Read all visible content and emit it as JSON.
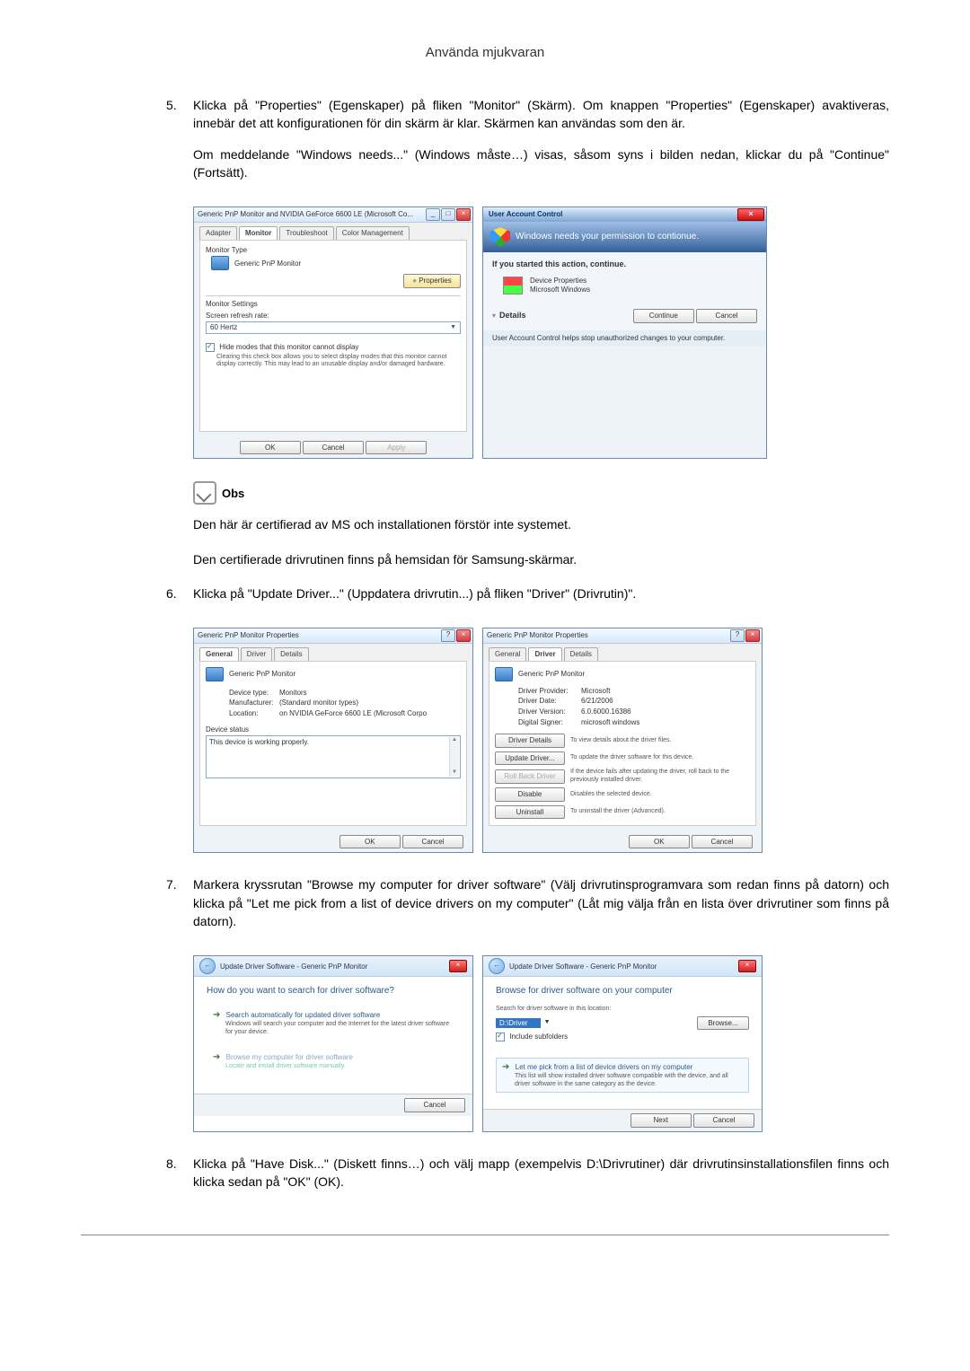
{
  "page_header": "Använda mjukvaran",
  "step5": {
    "num": "5.",
    "p1": "Klicka på \"Properties\" (Egenskaper) på fliken \"Monitor\" (Skärm). Om knappen \"Properties\" (Egenskaper) avaktiveras, innebär det att konfigurationen för din skärm är klar. Skärmen kan användas som den är.",
    "p2": "Om meddelande \"Windows needs...\" (Windows måste…) visas, såsom syns i bilden nedan, klickar du på \"Continue\" (Fortsätt)."
  },
  "dlg_monitor": {
    "title": "Generic PnP Monitor and NVIDIA GeForce 6600 LE (Microsoft Co...",
    "tabs": [
      "Adapter",
      "Monitor",
      "Troubleshoot",
      "Color Management"
    ],
    "monitor_type_label": "Monitor Type",
    "monitor_name": "Generic PnP Monitor",
    "properties_btn": "Properties",
    "monitor_settings_label": "Monitor Settings",
    "refresh_label": "Screen refresh rate:",
    "refresh_value": "60 Hertz",
    "hide_modes": "Hide modes that this monitor cannot display",
    "hide_modes_help": "Clearing this check box allows you to select display modes that this monitor cannot display correctly. This may lead to an unusable display and/or damaged hardware.",
    "ok": "OK",
    "cancel": "Cancel",
    "apply": "Apply"
  },
  "dlg_uac": {
    "title": "User Account Control",
    "headline": "Windows needs your permission to contionue.",
    "subline": "If you started this action, continue.",
    "prog_name": "Device Properties",
    "prog_pub": "Microsoft Windows",
    "details": "Details",
    "continue": "Continue",
    "cancel": "Cancel",
    "footer": "User Account Control helps stop unauthorized changes to your computer."
  },
  "note": {
    "label": "Obs",
    "line1": "Den här är certifierad av MS och installationen förstör inte systemet.",
    "line2": "Den certifierade drivrutinen finns på hemsidan för Samsung-skärmar."
  },
  "step6": {
    "num": "6.",
    "p1": "Klicka på \"Update Driver...\" (Uppdatera drivrutin...) på fliken \"Driver\" (Drivrutin)\"."
  },
  "dlg_prop_general": {
    "title": "Generic PnP Monitor Properties",
    "tabs": [
      "General",
      "Driver",
      "Details"
    ],
    "name": "Generic PnP Monitor",
    "device_type_l": "Device type:",
    "device_type_v": "Monitors",
    "manufacturer_l": "Manufacturer:",
    "manufacturer_v": "(Standard monitor types)",
    "location_l": "Location:",
    "location_v": "on NVIDIA GeForce 6600 LE (Microsoft Corpo",
    "status_l": "Device status",
    "status_v": "This device is working properly.",
    "ok": "OK",
    "cancel": "Cancel"
  },
  "dlg_prop_driver": {
    "title": "Generic PnP Monitor Properties",
    "tabs": [
      "General",
      "Driver",
      "Details"
    ],
    "name": "Generic PnP Monitor",
    "provider_l": "Driver Provider:",
    "provider_v": "Microsoft",
    "date_l": "Driver Date:",
    "date_v": "6/21/2006",
    "version_l": "Driver Version:",
    "version_v": "6.0.6000.16386",
    "signer_l": "Digital Signer:",
    "signer_v": "microsoft windows",
    "b1": "Driver Details",
    "b1d": "To view details about the driver files.",
    "b2": "Update Driver...",
    "b2d": "To update the driver software for this device.",
    "b3": "Roll Back Driver",
    "b3d": "If the device fails after updating the driver, roll back to the previously installed driver.",
    "b4": "Disable",
    "b4d": "Disables the selected device.",
    "b5": "Uninstall",
    "b5d": "To uninstall the driver (Advanced).",
    "ok": "OK",
    "cancel": "Cancel"
  },
  "step7": {
    "num": "7.",
    "p1": "Markera kryssrutan \"Browse my computer for driver software\" (Välj drivrutinsprogramvara som redan finns på datorn) och klicka på \"Let me pick from a list of device drivers on my computer\" (Låt mig välja från en lista över drivrutiner som finns på datorn)."
  },
  "dlg_wiz1": {
    "crumb": "Update Driver Software - Generic PnP Monitor",
    "heading": "How do you want to search for driver software?",
    "opt1_t": "Search automatically for updated driver software",
    "opt1_d": "Windows will search your computer and the Internet for the latest driver software for your device.",
    "opt2_t": "Browse my computer for driver software",
    "opt2_d": "Locate and install driver software manually.",
    "cancel": "Cancel"
  },
  "dlg_wiz2": {
    "crumb": "Update Driver Software - Generic PnP Monitor",
    "heading": "Browse for driver software on your computer",
    "search_l": "Search for driver software in this location:",
    "path": "D:\\Driver",
    "browse": "Browse...",
    "include": "Include subfolders",
    "opt_t": "Let me pick from a list of device drivers on my computer",
    "opt_d": "This list will show installed driver software compatible with the device, and all driver software in the same category as the device.",
    "next": "Next",
    "cancel": "Cancel"
  },
  "step8": {
    "num": "8.",
    "p1": "Klicka på \"Have Disk...\" (Diskett finns…) och välj mapp (exempelvis D:\\Drivrutiner) där drivrutinsinstallationsfilen finns och klicka sedan på \"OK\" (OK)."
  }
}
